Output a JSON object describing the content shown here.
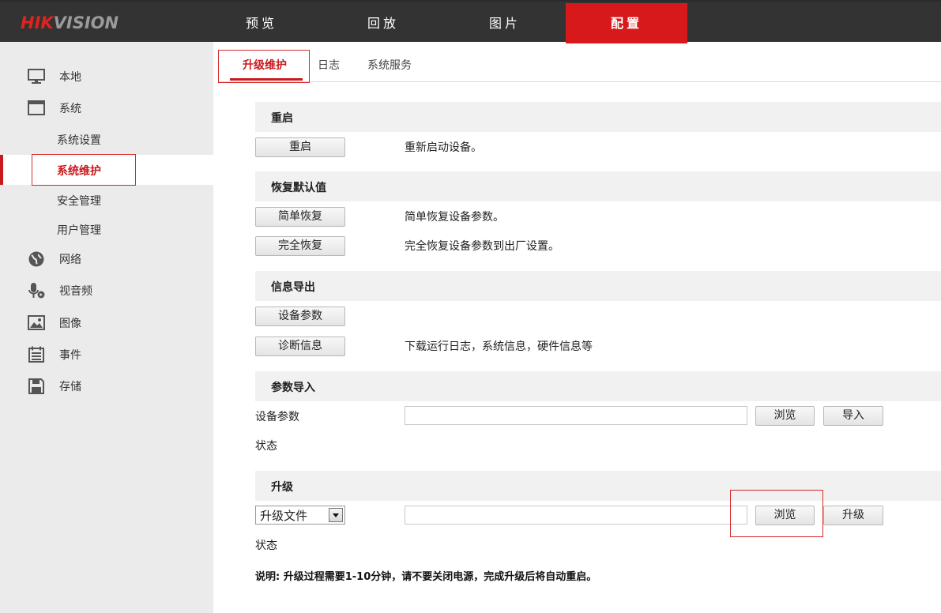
{
  "brand": {
    "logo_hik": "HIK",
    "logo_vision": "VISION"
  },
  "nav": [
    {
      "label": "预览"
    },
    {
      "label": "回放"
    },
    {
      "label": "图片"
    },
    {
      "label": "配置",
      "active": true
    }
  ],
  "sidebar": {
    "items": [
      {
        "label": "本地",
        "icon": "monitor-icon"
      },
      {
        "label": "系统",
        "icon": "window-icon"
      },
      {
        "label": "网络",
        "icon": "globe-icon"
      },
      {
        "label": "视音频",
        "icon": "microphone-icon"
      },
      {
        "label": "图像",
        "icon": "image-icon"
      },
      {
        "label": "事件",
        "icon": "calendar-icon"
      },
      {
        "label": "存储",
        "icon": "floppy-icon"
      }
    ],
    "sub_items": [
      {
        "label": "系统设置"
      },
      {
        "label": "系统维护",
        "active": true
      },
      {
        "label": "安全管理"
      },
      {
        "label": "用户管理"
      }
    ]
  },
  "tabs": [
    {
      "label": "升级维护",
      "active": true
    },
    {
      "label": "日志"
    },
    {
      "label": "系统服务"
    }
  ],
  "reboot": {
    "title": "重启",
    "button": "重启",
    "desc": "重新启动设备。"
  },
  "restore": {
    "title": "恢复默认值",
    "simple_button": "简单恢复",
    "simple_desc": "简单恢复设备参数。",
    "full_button": "完全恢复",
    "full_desc": "完全恢复设备参数到出厂设置。"
  },
  "export": {
    "title": "信息导出",
    "device_params_button": "设备参数",
    "diagnostic_button": "诊断信息",
    "diagnostic_desc": "下载运行日志，系统信息，硬件信息等"
  },
  "import": {
    "title": "参数导入",
    "label": "设备参数",
    "file_value": "",
    "browse_button": "浏览",
    "import_button": "导入",
    "status_label": "状态"
  },
  "upgrade": {
    "title": "升级",
    "select_value": "升级文件",
    "file_value": "",
    "browse_button": "浏览",
    "upgrade_button": "升级",
    "status_label": "状态",
    "note": "说明: 升级过程需要1-10分钟，请不要关闭电源，完成升级后将自动重启。"
  },
  "colors": {
    "accent": "#d7191c",
    "topbar": "#333333",
    "sidebar": "#ebebeb",
    "highlight_box": "#d42b2b"
  }
}
